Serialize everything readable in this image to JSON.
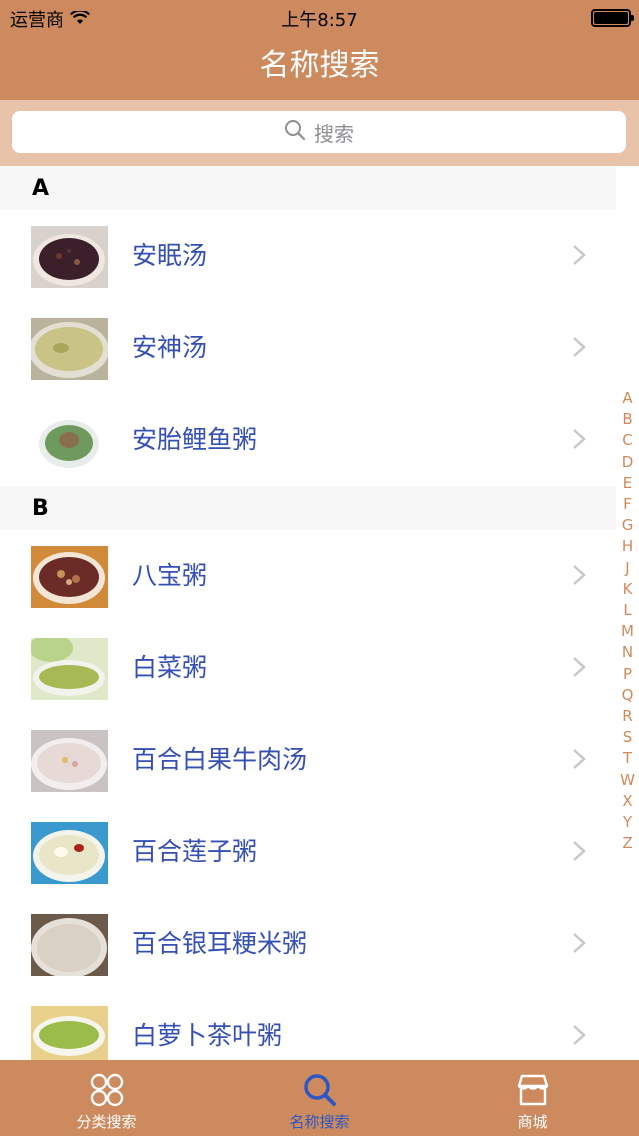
{
  "status_bar": {
    "carrier": "运营商",
    "time": "上午8:57"
  },
  "nav": {
    "title": "名称搜索"
  },
  "search": {
    "placeholder": "搜索"
  },
  "sections": [
    {
      "letter": "A",
      "items": [
        {
          "label": "安眠汤",
          "thumb": "purple-rice-soup"
        },
        {
          "label": "安神汤",
          "thumb": "green-soup"
        },
        {
          "label": "安胎鲤鱼粥",
          "thumb": "carp-porridge"
        }
      ]
    },
    {
      "letter": "B",
      "items": [
        {
          "label": "八宝粥",
          "thumb": "eight-treasure-porridge"
        },
        {
          "label": "白菜粥",
          "thumb": "cabbage-porridge"
        },
        {
          "label": "百合白果牛肉汤",
          "thumb": "lily-ginkgo-beef-soup"
        },
        {
          "label": "百合莲子粥",
          "thumb": "lily-lotus-seed-porridge"
        },
        {
          "label": "百合银耳粳米粥",
          "thumb": "lily-tremella-rice-porridge"
        },
        {
          "label": "白萝卜茶叶粥",
          "thumb": "radish-tea-porridge"
        }
      ]
    }
  ],
  "index_letters": [
    "A",
    "B",
    "C",
    "D",
    "E",
    "F",
    "G",
    "H",
    "J",
    "K",
    "L",
    "M",
    "N",
    "P",
    "Q",
    "R",
    "S",
    "T",
    "W",
    "X",
    "Y",
    "Z"
  ],
  "tabs": [
    {
      "label": "分类搜索",
      "icon": "category-icon",
      "active": false
    },
    {
      "label": "名称搜索",
      "icon": "search-icon",
      "active": true
    },
    {
      "label": "商城",
      "icon": "store-icon",
      "active": false
    }
  ],
  "colors": {
    "primary": "#cd8a5e",
    "search_band": "#e8c3a9",
    "link_text": "#3550b2",
    "active_tab": "#2c57c4",
    "index_text": "#d08a5a"
  }
}
